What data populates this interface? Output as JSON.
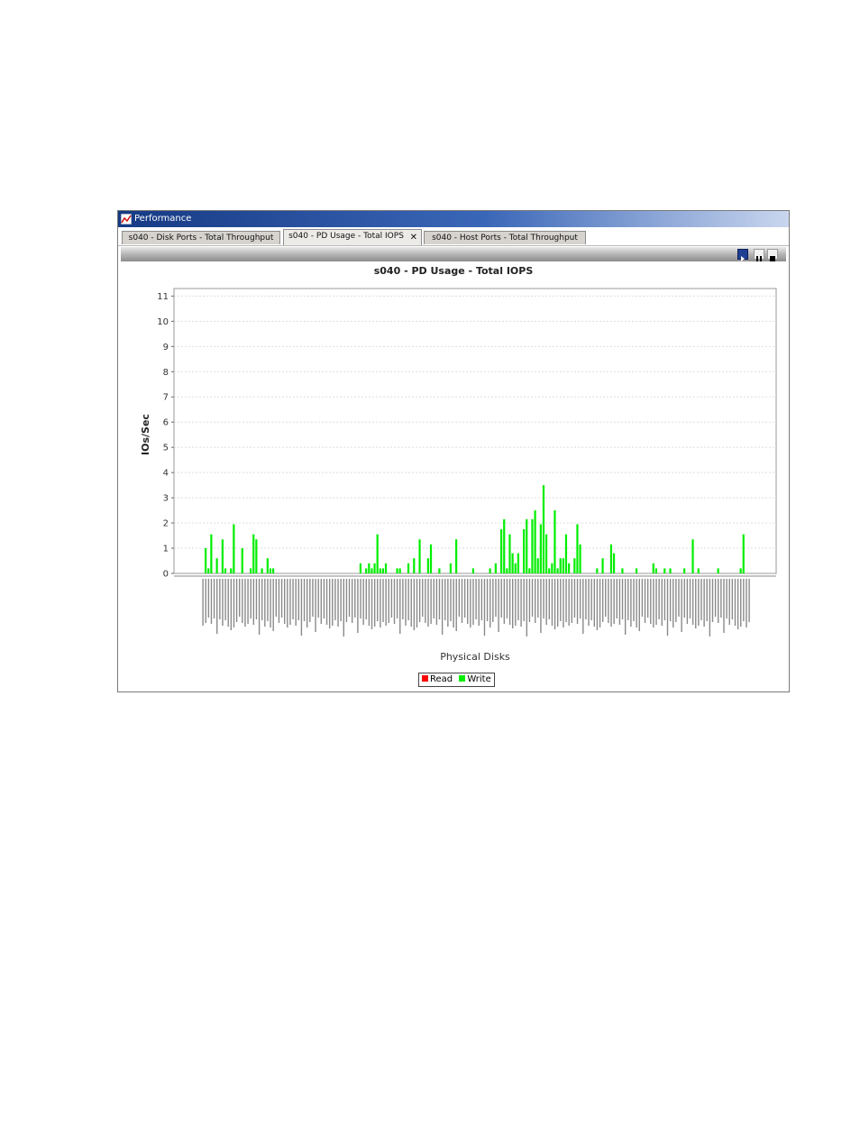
{
  "window": {
    "title": "Performance"
  },
  "tabs": [
    {
      "label": "s040 - Disk Ports - Total Throughput",
      "active": false
    },
    {
      "label": "s040 - PD Usage - Total IOPS",
      "active": true,
      "closable": true
    },
    {
      "label": "s040 - Host Ports - Total Throughput",
      "active": false
    }
  ],
  "toolbar": {
    "buttons": [
      "play-icon",
      "pause-icon",
      "stop-icon"
    ]
  },
  "colors": {
    "read": "#ff0000",
    "write": "#00ee00",
    "play_button": "#1f3f93"
  },
  "chart_data": {
    "type": "bar",
    "title": "s040 - PD Usage - Total IOPS",
    "xlabel": "Physical Disks",
    "ylabel": "IOs/Sec",
    "ylim": [
      0,
      11.3
    ],
    "yticks": [
      0,
      1,
      2,
      3,
      4,
      5,
      6,
      7,
      8,
      9,
      10,
      11
    ],
    "grid": true,
    "legend_placement": "bottom-center",
    "series": [
      {
        "name": "Read",
        "color": "#ff0000",
        "values": []
      },
      {
        "name": "Write",
        "color": "#00ee00",
        "values": [
          0,
          0,
          0,
          0,
          0,
          0,
          0,
          0,
          0,
          0,
          0,
          0,
          0,
          0,
          0,
          0,
          0,
          0,
          0,
          0,
          0,
          0,
          0,
          0,
          0,
          0,
          0,
          0,
          0,
          0,
          0,
          0,
          0,
          0,
          0,
          0,
          0,
          0,
          0,
          0,
          0,
          0,
          0,
          0,
          0,
          0,
          0,
          0,
          0,
          0,
          0,
          0,
          0,
          0,
          0,
          0,
          0,
          0,
          0,
          0,
          0,
          0,
          0,
          0,
          0,
          0,
          0,
          0,
          0,
          0,
          0,
          0,
          0,
          0,
          0,
          0,
          0,
          0,
          0,
          0,
          0,
          0,
          0,
          0,
          0,
          0,
          0,
          0,
          0,
          0,
          0,
          0,
          0,
          0,
          0,
          0,
          0,
          0,
          0,
          0,
          0,
          0,
          0,
          0,
          0,
          0,
          0,
          0,
          0,
          0,
          0,
          0,
          0,
          0,
          0,
          0,
          0,
          0,
          0,
          0,
          0,
          0,
          0,
          0,
          0,
          0,
          0,
          0,
          0,
          0,
          0,
          0,
          0,
          0,
          0,
          0,
          0,
          0,
          0,
          0,
          0,
          0,
          0,
          0,
          0,
          0,
          0,
          0,
          0,
          0,
          0,
          0,
          0,
          0,
          0,
          0,
          0,
          0,
          0,
          0,
          0,
          0,
          0,
          0,
          0,
          0,
          0,
          0,
          0,
          0,
          0,
          0,
          0,
          0,
          0,
          0,
          0,
          0,
          0,
          0,
          0,
          0,
          0,
          0,
          0,
          0,
          0,
          0,
          0,
          0,
          0,
          0,
          0,
          0,
          0,
          0,
          0,
          0,
          0,
          0,
          0,
          0,
          0,
          0,
          0,
          0,
          0,
          0,
          0,
          0,
          0,
          0,
          0,
          0,
          0,
          0,
          0,
          0,
          0,
          0,
          0,
          0,
          0,
          0,
          0,
          0,
          0,
          0,
          0,
          0,
          0,
          0,
          0,
          0,
          0,
          0,
          0,
          0,
          0,
          0
        ]
      }
    ],
    "write_bars": [
      [
        1,
        1.0
      ],
      [
        2,
        0.2
      ],
      [
        3,
        1.55
      ],
      [
        5,
        0.6
      ],
      [
        7,
        1.35
      ],
      [
        8,
        0.2
      ],
      [
        10,
        0.2
      ],
      [
        11,
        1.95
      ],
      [
        14,
        1.0
      ],
      [
        17,
        0.2
      ],
      [
        18,
        1.55
      ],
      [
        19,
        1.35
      ],
      [
        21,
        0.2
      ],
      [
        23,
        0.6
      ],
      [
        24,
        0.2
      ],
      [
        25,
        0.2
      ],
      [
        56,
        0.4
      ],
      [
        58,
        0.2
      ],
      [
        59,
        0.4
      ],
      [
        60,
        0.2
      ],
      [
        61,
        0.4
      ],
      [
        62,
        1.55
      ],
      [
        63,
        0.2
      ],
      [
        64,
        0.2
      ],
      [
        65,
        0.4
      ],
      [
        69,
        0.2
      ],
      [
        70,
        0.2
      ],
      [
        73,
        0.4
      ],
      [
        75,
        0.6
      ],
      [
        77,
        1.35
      ],
      [
        80,
        0.6
      ],
      [
        81,
        1.15
      ],
      [
        84,
        0.2
      ],
      [
        88,
        0.4
      ],
      [
        90,
        1.35
      ],
      [
        96,
        0.2
      ],
      [
        102,
        0.2
      ],
      [
        104,
        0.4
      ],
      [
        106,
        1.75
      ],
      [
        107,
        2.15
      ],
      [
        108,
        0.2
      ],
      [
        109,
        1.55
      ],
      [
        110,
        0.8
      ],
      [
        111,
        0.4
      ],
      [
        112,
        0.8
      ],
      [
        114,
        1.75
      ],
      [
        115,
        2.15
      ],
      [
        116,
        0.2
      ],
      [
        117,
        2.15
      ],
      [
        118,
        2.5
      ],
      [
        119,
        0.6
      ],
      [
        120,
        1.95
      ],
      [
        121,
        3.5
      ],
      [
        122,
        1.55
      ],
      [
        123,
        0.2
      ],
      [
        124,
        0.4
      ],
      [
        125,
        2.5
      ],
      [
        126,
        0.2
      ],
      [
        127,
        0.6
      ],
      [
        128,
        0.6
      ],
      [
        129,
        1.55
      ],
      [
        130,
        0.4
      ],
      [
        132,
        0.6
      ],
      [
        133,
        1.95
      ],
      [
        134,
        1.15
      ],
      [
        140,
        0.2
      ],
      [
        142,
        0.6
      ],
      [
        145,
        1.15
      ],
      [
        146,
        0.8
      ],
      [
        149,
        0.2
      ],
      [
        154,
        0.2
      ],
      [
        160,
        0.4
      ],
      [
        161,
        0.2
      ],
      [
        164,
        0.2
      ],
      [
        166,
        0.2
      ],
      [
        171,
        0.2
      ],
      [
        174,
        1.35
      ],
      [
        176,
        0.2
      ],
      [
        183,
        0.2
      ],
      [
        191,
        0.2
      ],
      [
        192,
        1.55
      ]
    ],
    "category_count": 195
  },
  "legend": {
    "read": "Read",
    "write": "Write"
  }
}
